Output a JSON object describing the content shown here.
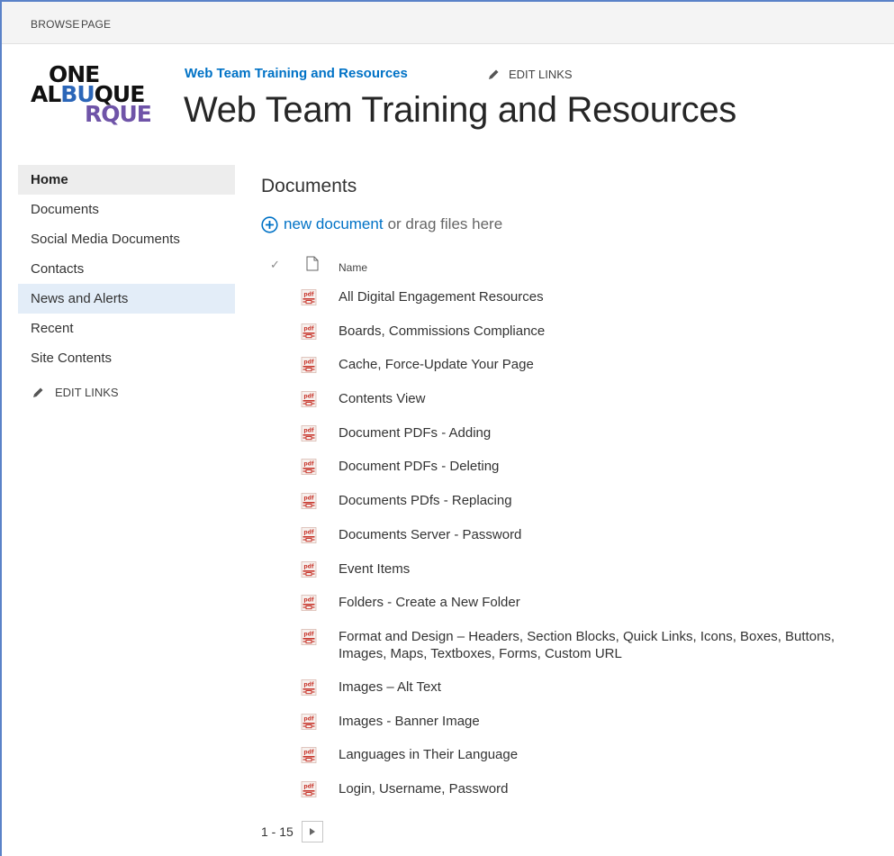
{
  "ribbon": {
    "tabs": [
      "BROWSE",
      "PAGE"
    ]
  },
  "logo": {
    "line1": "ONE",
    "line2_a": "AL",
    "line2_b": "BU",
    "line2_c": "QUE",
    "line3": "RQUE"
  },
  "header": {
    "site_link": "Web Team Training and Resources",
    "edit_links": "EDIT LINKS",
    "title": "Web Team Training and Resources"
  },
  "nav": {
    "items": [
      "Home",
      "Documents",
      "Social Media Documents",
      "Contacts",
      "News and Alerts",
      "Recent",
      "Site Contents"
    ],
    "edit_links": "EDIT LINKS"
  },
  "documents": {
    "title": "Documents",
    "new_link": "new document",
    "drag_text": "or drag files here",
    "column_check": "✓",
    "column_name": "Name",
    "file_icon": "pdf-icon",
    "items": [
      "All Digital Engagement Resources",
      "Boards, Commissions Compliance",
      "Cache, Force-Update Your Page",
      "Contents View",
      "Document PDFs - Adding",
      "Document PDFs - Deleting",
      "Documents PDfs - Replacing",
      "Documents Server - Password",
      "Event Items",
      "Folders - Create a New Folder",
      "Format and Design – Headers, Section Blocks, Quick Links, Icons, Boxes, Buttons, Images, Maps, Textboxes, Forms, Custom URL",
      "Images – Alt Text",
      "Images - Banner Image",
      "Languages in Their Language",
      "Login, Username, Password"
    ]
  },
  "pager": {
    "range": "1 - 15"
  },
  "colors": {
    "link_blue": "#0072c6",
    "pdf_red": "#c8372d",
    "nav_hover": "#e3edf8"
  }
}
